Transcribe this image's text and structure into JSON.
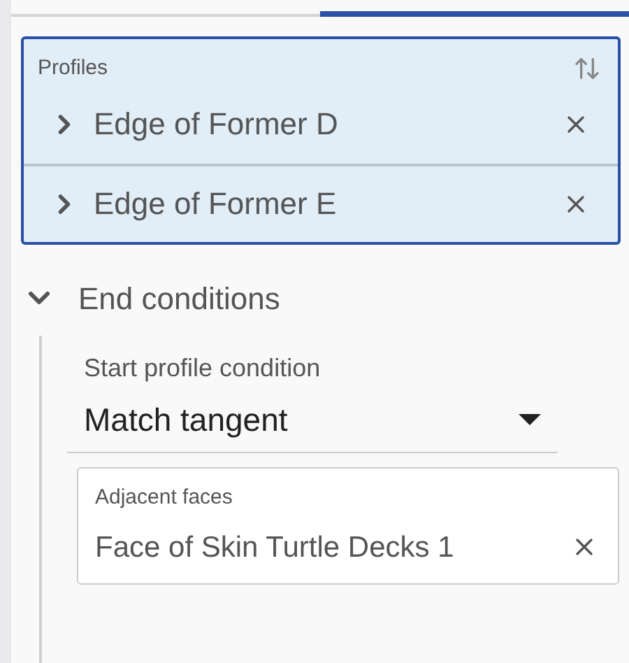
{
  "tabs": [
    {
      "selected": false
    },
    {
      "selected": true
    }
  ],
  "profiles": {
    "label": "Profiles",
    "items": [
      {
        "name": "Edge of Former D",
        "expanded": false
      },
      {
        "name": "Edge of Former E",
        "expanded": false
      }
    ]
  },
  "end_conditions": {
    "title": "End conditions",
    "expanded": true,
    "start_profile_condition": {
      "label": "Start profile condition",
      "value": "Match tangent"
    },
    "adjacent_faces": {
      "label": "Adjacent faces",
      "items": [
        "Face of Skin Turtle Decks 1"
      ]
    }
  }
}
